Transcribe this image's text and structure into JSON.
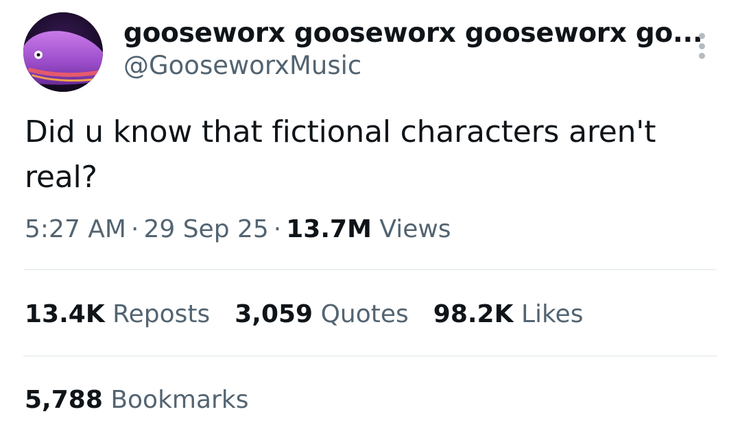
{
  "author": {
    "display_name": "gooseworx gooseworx gooseworx go...",
    "handle": "@GooseworxMusic",
    "avatar_icon": "purple-creature-avatar"
  },
  "tweet": {
    "text": "Did u know that fictional characters aren't real?"
  },
  "meta": {
    "time": "5:27 AM",
    "date": "29 Sep 25",
    "views_count": "13.7M",
    "views_label": "Views",
    "separator": "·"
  },
  "stats": {
    "reposts_count": "13.4K",
    "reposts_label": "Reposts",
    "quotes_count": "3,059",
    "quotes_label": "Quotes",
    "likes_count": "98.2K",
    "likes_label": "Likes",
    "bookmarks_count": "5,788",
    "bookmarks_label": "Bookmarks"
  },
  "icons": {
    "more": "more-vertical-icon"
  },
  "colors": {
    "text_primary": "#0f1419",
    "text_secondary": "#536471",
    "divider": "#e1e6ea",
    "background": "#ffffff"
  }
}
